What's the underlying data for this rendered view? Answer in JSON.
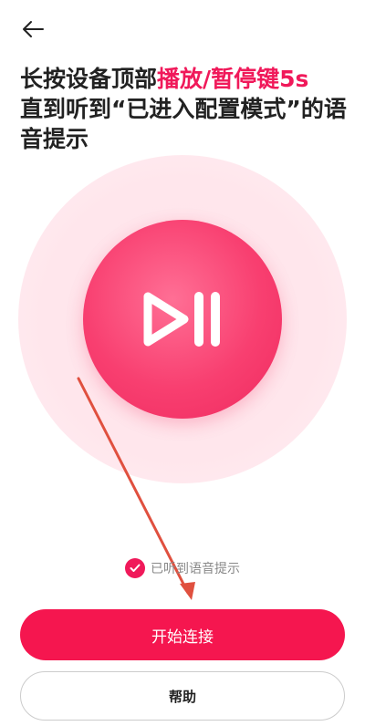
{
  "header": {
    "back_icon": "arrow-left-icon"
  },
  "instruction": {
    "part1": "长按设备顶部",
    "highlight": "播放/暂停键5s",
    "part2": "直到听到“已进入配置模式”的语音提示"
  },
  "illustration": {
    "icon": "play-pause-icon"
  },
  "confirm": {
    "label": "已听到语音提示",
    "checked": true,
    "icon": "check-icon"
  },
  "buttons": {
    "primary_label": "开始连接",
    "secondary_label": "帮助"
  },
  "colors": {
    "accent": "#f5164f",
    "highlight_text": "#f0195a",
    "outer_circle": "#ffe6ec",
    "annotation_arrow": "#e0503f"
  }
}
